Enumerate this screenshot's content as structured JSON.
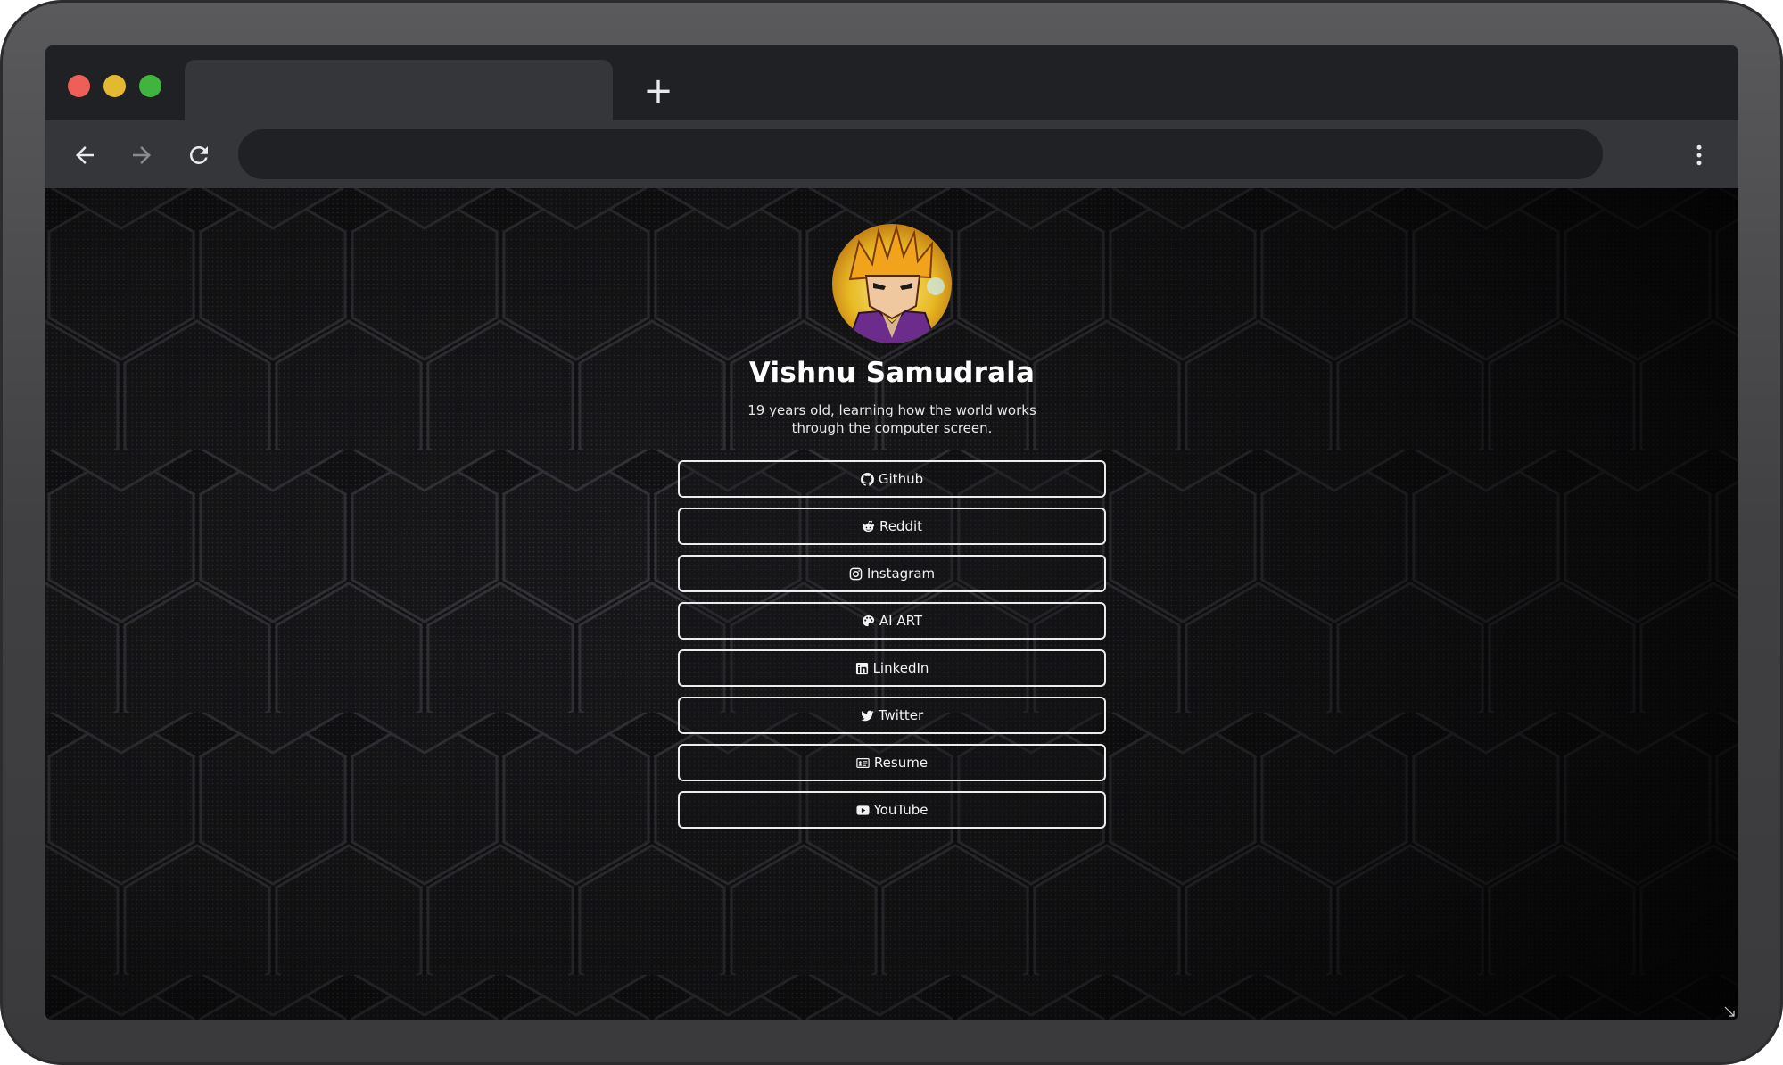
{
  "browser": {
    "traffic_lights": {
      "close": "#ed5f58",
      "minimize": "#e3b92f",
      "maximize": "#3fb53f"
    },
    "new_tab_label": "+",
    "icons": {
      "back": "arrow-left-icon",
      "forward": "arrow-right-icon",
      "reload": "reload-icon",
      "menu": "kebab-menu-icon"
    }
  },
  "profile": {
    "name": "Vishnu Samudrala",
    "bio": "19 years old, learning how the world works through the computer screen."
  },
  "links": [
    {
      "label": "Github",
      "icon": "github-icon"
    },
    {
      "label": "Reddit",
      "icon": "reddit-icon"
    },
    {
      "label": "Instagram",
      "icon": "instagram-icon"
    },
    {
      "label": "AI ART",
      "icon": "palette-icon"
    },
    {
      "label": "LinkedIn",
      "icon": "linkedin-icon"
    },
    {
      "label": "Twitter",
      "icon": "twitter-icon"
    },
    {
      "label": "Resume",
      "icon": "id-card-icon"
    },
    {
      "label": "YouTube",
      "icon": "youtube-icon"
    }
  ],
  "theme": {
    "background": "#101011",
    "hex_edge": "#3c3c40",
    "button_border": "#ececec"
  }
}
